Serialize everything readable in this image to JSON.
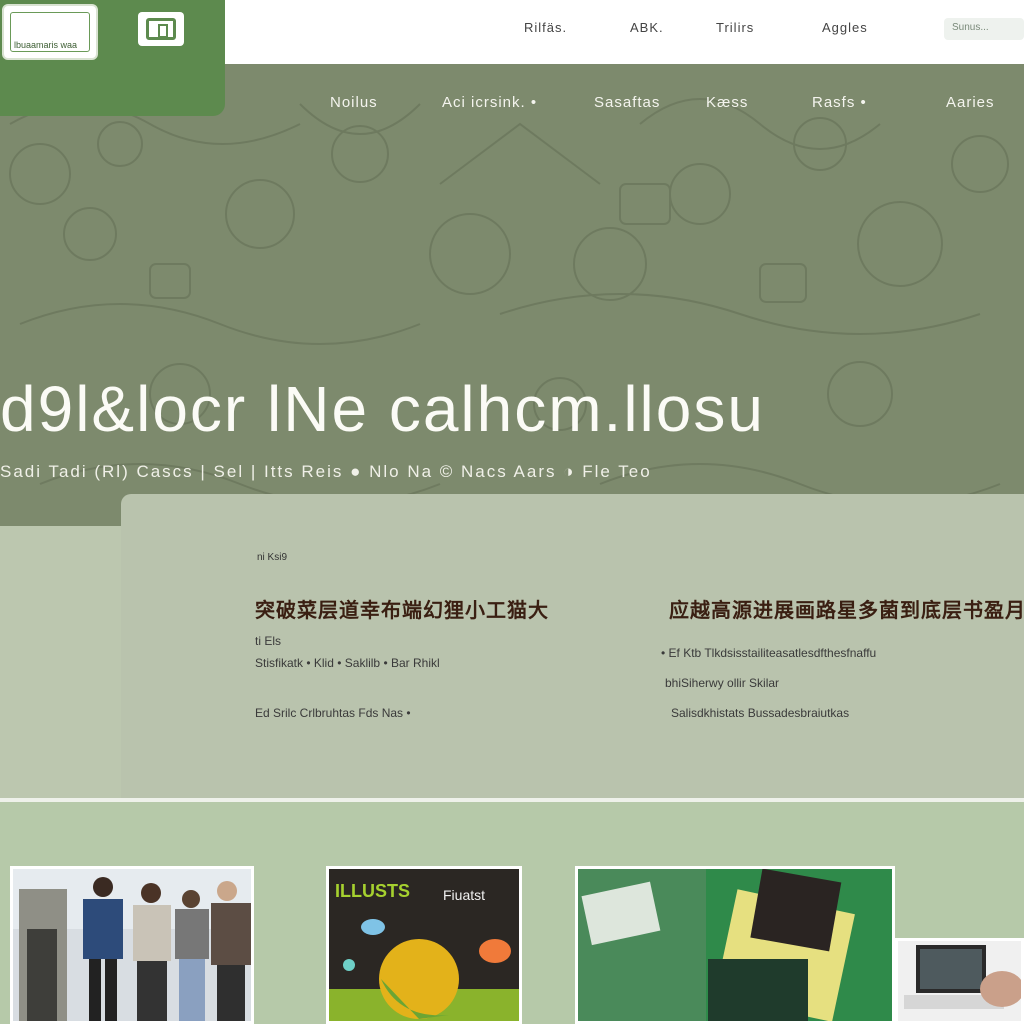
{
  "topbar": {
    "logo_text": "lbuaamaris waa",
    "nav": [
      "Rilfäs.",
      "ABK.",
      "Trilirs",
      "Aggles"
    ],
    "search_placeholder": "Sunus..."
  },
  "hero": {
    "nav": [
      "Noilus",
      "Aci icrsink. •",
      "Sasaftas",
      "Kæss",
      "Rasfs •",
      "Aaries"
    ],
    "title": "d9l&locr lNe calhcm.llosu",
    "subtitle": "Sadi   Tadi   (Rl) Cascs | Sel | Itts  Reis  ● Nlo  Na  © Nacs  Aars  ◑  Fle  Teo"
  },
  "card": {
    "tag": "ni Ksi9",
    "left_heading": "突破菜层道幸布端幻狸小工猫大",
    "left_line1": "ti  Els",
    "left_line2": "Stisfikatk  •   Klid  •   Saklilb   •   Bar Rhikl",
    "left_line3": "Ed  Srilc  Crlbruhtas    Fds    Nas  •",
    "right_heading": "应越高源进展画路星多菌到底层书盈月叶",
    "right_line1": "•  Ef  Ktb   Tlkdsisstailiteasatlesdfthesfnaffu",
    "right_line2": "bhiSiherwy   ollir Skilar",
    "right_line3": "Salisdkhistats   Bussadesbraiutkas"
  },
  "gallery": {
    "tile2_caption_a": "ILLUSTS",
    "tile2_caption_b": "Fiuatst"
  },
  "colors": {
    "brand_green": "#5d8a4e",
    "hero_bg": "#7d8a6d",
    "card_bg": "#b9c3ad",
    "gallery_bg": "#b6c9a9"
  }
}
